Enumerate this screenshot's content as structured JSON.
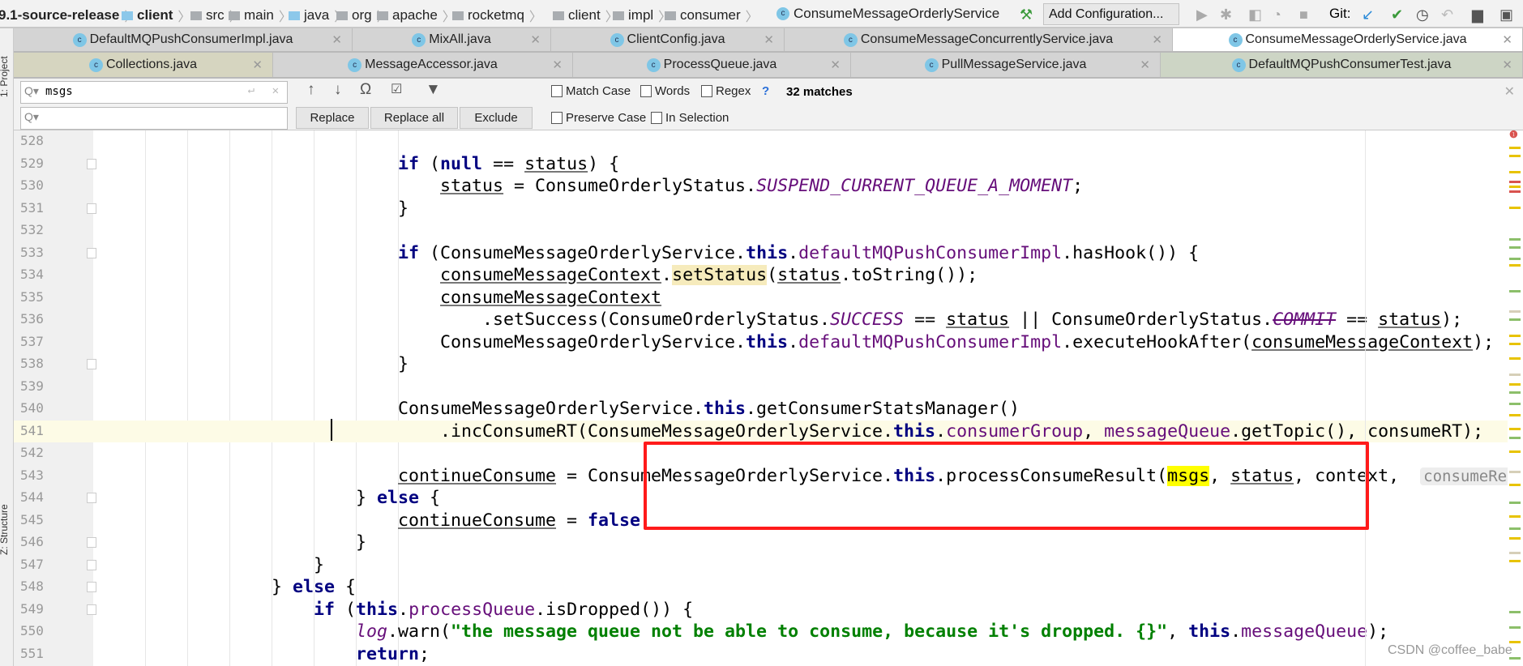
{
  "breadcrumb": [
    {
      "label": "9.1-source-release",
      "bold": true,
      "icon": "none"
    },
    {
      "label": "client",
      "bold": true,
      "icon": "module-folder-icon"
    },
    {
      "label": "src",
      "icon": "folder-icon"
    },
    {
      "label": "main",
      "icon": "folder-icon"
    },
    {
      "label": "java",
      "icon": "source-folder-icon"
    },
    {
      "label": "org",
      "icon": "package-icon"
    },
    {
      "label": "apache",
      "icon": "package-icon"
    },
    {
      "label": "rocketmq",
      "icon": "package-icon"
    },
    {
      "label": "client",
      "icon": "package-icon"
    },
    {
      "label": "impl",
      "icon": "package-icon"
    },
    {
      "label": "consumer",
      "icon": "package-icon"
    },
    {
      "label": "ConsumeMessageOrderlyService",
      "icon": "class-icon"
    }
  ],
  "toolbar": {
    "add_configuration": "Add Configuration...",
    "git_label": "Git:"
  },
  "tool_windows": {
    "project": "1: Project",
    "structure": "Z: Structure"
  },
  "tabs_row1": [
    {
      "label": "DefaultMQPushConsumerImpl.java"
    },
    {
      "label": "MixAll.java"
    },
    {
      "label": "ClientConfig.java"
    },
    {
      "label": "ConsumeMessageConcurrentlyService.java"
    },
    {
      "label": "ConsumeMessageOrderlyService.java",
      "active": true
    }
  ],
  "tabs_row2": [
    {
      "label": "Collections.java"
    },
    {
      "label": "MessageAccessor.java"
    },
    {
      "label": "ProcessQueue.java"
    },
    {
      "label": "PullMessageService.java"
    },
    {
      "label": "DefaultMQPushConsumerTest.java"
    }
  ],
  "find": {
    "search_value": "msgs",
    "replace_value": "",
    "replace": "Replace",
    "replace_all": "Replace all",
    "exclude": "Exclude",
    "match_case": "Match Case",
    "words": "Words",
    "regex": "Regex",
    "help": "?",
    "matches": "32 matches",
    "preserve_case": "Preserve Case",
    "in_selection": "In Selection",
    "options_checked": {
      "match_case": false,
      "words": false,
      "regex": false,
      "preserve_case": false,
      "in_selection": false
    }
  },
  "editor": {
    "current_line": 541,
    "lines": [
      {
        "n": "528",
        "t": []
      },
      {
        "n": "529",
        "t": [
          [
            "                            if",
            "k"
          ],
          [
            " ("
          ],
          [
            "null",
            "k"
          ],
          [
            " == "
          ],
          [
            "status",
            "u"
          ],
          [
            ") {"
          ]
        ]
      },
      {
        "n": "530",
        "t": [
          [
            "                                "
          ],
          [
            "status",
            "u"
          ],
          [
            " = ConsumeOrderlyStatus."
          ],
          [
            "SUSPEND_CURRENT_QUEUE_A_MOMENT",
            "s"
          ],
          [
            ";"
          ]
        ]
      },
      {
        "n": "531",
        "t": [
          [
            "                            }"
          ]
        ]
      },
      {
        "n": "532",
        "t": []
      },
      {
        "n": "533",
        "t": [
          [
            "                            if",
            "k"
          ],
          [
            " (ConsumeMessageOrderlyService."
          ],
          [
            "this",
            "k"
          ],
          [
            "."
          ],
          [
            "defaultMQPushConsumerImpl",
            "f"
          ],
          [
            ".hasHook()) {"
          ]
        ]
      },
      {
        "n": "534",
        "t": [
          [
            "                                "
          ],
          [
            "consumeMessageContext",
            "u"
          ],
          [
            "."
          ],
          [
            "setStatus",
            "hl"
          ],
          [
            "("
          ],
          [
            "status",
            "u"
          ],
          [
            ".toString());"
          ]
        ]
      },
      {
        "n": "535",
        "t": [
          [
            "                                "
          ],
          [
            "consumeMessageContext",
            "u"
          ]
        ]
      },
      {
        "n": "536",
        "t": [
          [
            "                                    .setSuccess(ConsumeOrderlyStatus."
          ],
          [
            "SUCCESS",
            "s"
          ],
          [
            " == "
          ],
          [
            "status",
            "u"
          ],
          [
            " || ConsumeOrderlyStatus."
          ],
          [
            "COMMIT",
            "st"
          ],
          [
            " == "
          ],
          [
            "status",
            "u"
          ],
          [
            ");"
          ]
        ]
      },
      {
        "n": "537",
        "t": [
          [
            "                                ConsumeMessageOrderlyService."
          ],
          [
            "this",
            "k"
          ],
          [
            "."
          ],
          [
            "defaultMQPushConsumerImpl",
            "f"
          ],
          [
            ".executeHookAfter("
          ],
          [
            "consumeMessageContext",
            "u"
          ],
          [
            ");"
          ]
        ]
      },
      {
        "n": "538",
        "t": [
          [
            "                            }"
          ]
        ]
      },
      {
        "n": "539",
        "t": []
      },
      {
        "n": "540",
        "t": [
          [
            "                            ConsumeMessageOrderlyService."
          ],
          [
            "this",
            "k"
          ],
          [
            ".getConsumerStatsManager()"
          ]
        ]
      },
      {
        "n": "541",
        "t": [
          [
            "                                .incConsumeRT(ConsumeMessageOrderlyService."
          ],
          [
            "this",
            "k"
          ],
          [
            "."
          ],
          [
            "consumerGroup",
            "f"
          ],
          [
            ", "
          ],
          [
            "messageQueue",
            "f"
          ],
          [
            ".getTopic(), consumeRT);"
          ]
        ]
      },
      {
        "n": "542",
        "t": []
      },
      {
        "n": "543",
        "t": [
          [
            "                            "
          ],
          [
            "continueConsume",
            "u"
          ],
          [
            " = ConsumeMessageOrderlyService."
          ],
          [
            "this",
            "k"
          ],
          [
            ".processConsumeResult("
          ],
          [
            "msgs",
            "found"
          ],
          [
            ", "
          ],
          [
            "status",
            "u"
          ],
          [
            ", context,  "
          ],
          [
            "consumeRequest:",
            "hint"
          ]
        ]
      },
      {
        "n": "544",
        "t": [
          [
            "                        } "
          ],
          [
            "else",
            "k"
          ],
          [
            " {"
          ]
        ]
      },
      {
        "n": "545",
        "t": [
          [
            "                            "
          ],
          [
            "continueConsume",
            "u"
          ],
          [
            " = "
          ],
          [
            "false",
            "k"
          ],
          [
            ";"
          ]
        ]
      },
      {
        "n": "546",
        "t": [
          [
            "                        }"
          ]
        ]
      },
      {
        "n": "547",
        "t": [
          [
            "                    }"
          ]
        ]
      },
      {
        "n": "548",
        "t": [
          [
            "                } "
          ],
          [
            "else",
            "k"
          ],
          [
            " {"
          ]
        ]
      },
      {
        "n": "549",
        "t": [
          [
            "                    if",
            "k"
          ],
          [
            " ("
          ],
          [
            "this",
            "k"
          ],
          [
            "."
          ],
          [
            "processQueue",
            "f"
          ],
          [
            ".isDropped()) {"
          ]
        ]
      },
      {
        "n": "550",
        "t": [
          [
            "                        "
          ],
          [
            "log",
            "s"
          ],
          [
            ".warn("
          ],
          [
            "\"the message queue not be able to consume, because it's dropped. {}\"",
            "str"
          ],
          [
            ", "
          ],
          [
            "this",
            "k"
          ],
          [
            "."
          ],
          [
            "messageQueue",
            "f"
          ],
          [
            ");"
          ]
        ]
      },
      {
        "n": "551",
        "t": [
          [
            "                        "
          ],
          [
            "return",
            "k"
          ],
          [
            ";"
          ]
        ]
      }
    ]
  },
  "watermark": "CSDN @coffee_babe",
  "colors": {
    "keyword": "#000080",
    "field": "#660e7a",
    "string": "#008000",
    "search_match": "#ffff00",
    "annotation_box": "#ff1a1a",
    "current_line": "#fdfbe6"
  }
}
